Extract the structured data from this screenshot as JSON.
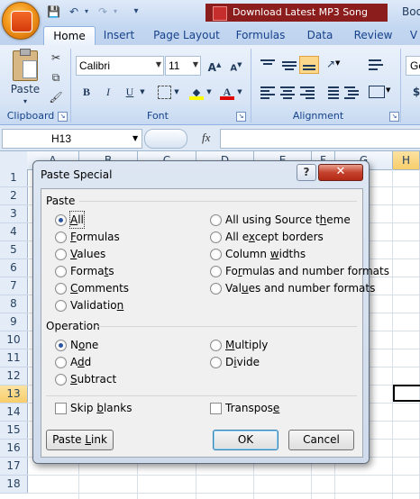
{
  "title_bar": {
    "quick_access": {
      "save": "💾",
      "undo": "↶",
      "undo_dd": "▾",
      "redo": "↷",
      "redo_dd": "▾",
      "customize": "▾"
    },
    "taskbar_app_label": "Download Latest MP3 Song",
    "window_title": "Boo"
  },
  "tabs": [
    "Home",
    "Insert",
    "Page Layout",
    "Formulas",
    "Data",
    "Review",
    "V"
  ],
  "ribbon": {
    "clipboard": {
      "paste_label": "Paste",
      "group_label": "Clipboard"
    },
    "font": {
      "name": "Calibri",
      "size": "11",
      "group_label": "Font",
      "bold": "B",
      "italic": "I",
      "underline": "U",
      "color_glyph": "A",
      "grow": "A",
      "shrink": "A"
    },
    "alignment": {
      "group_label": "Alignment"
    },
    "number": {
      "format_value": "Ge",
      "currency": "$"
    }
  },
  "formula_bar": {
    "name_box": "H13",
    "fx": "fx",
    "formula": ""
  },
  "grid": {
    "columns": [
      "A",
      "B",
      "C",
      "D",
      "E",
      "F",
      "G",
      "H"
    ],
    "rows": [
      "1",
      "2",
      "3",
      "4",
      "5",
      "6",
      "7",
      "8",
      "9",
      "10",
      "11",
      "12",
      "13",
      "14",
      "15",
      "16",
      "17",
      "18"
    ],
    "selected_row": "13",
    "selected_col": "H"
  },
  "dialog": {
    "title": "Paste Special",
    "help": "?",
    "close": "✕",
    "paste_section": "Paste",
    "paste_options_left": [
      {
        "pre": "",
        "key": "A",
        "post": "ll",
        "selected": true
      },
      {
        "pre": "",
        "key": "F",
        "post": "ormulas",
        "selected": false
      },
      {
        "pre": "",
        "key": "V",
        "post": "alues",
        "selected": false
      },
      {
        "pre": "Forma",
        "key": "t",
        "post": "s",
        "selected": false
      },
      {
        "pre": "",
        "key": "C",
        "post": "omments",
        "selected": false
      },
      {
        "pre": "Validatio",
        "key": "n",
        "post": "",
        "selected": false
      }
    ],
    "paste_options_right": [
      {
        "pre": "All using Source t",
        "key": "h",
        "post": "eme",
        "selected": false
      },
      {
        "pre": "All e",
        "key": "x",
        "post": "cept borders",
        "selected": false
      },
      {
        "pre": "Column ",
        "key": "w",
        "post": "idths",
        "selected": false
      },
      {
        "pre": "Fo",
        "key": "r",
        "post": "mulas and number formats",
        "selected": false
      },
      {
        "pre": "Val",
        "key": "u",
        "post": "es and number formats",
        "selected": false
      }
    ],
    "operation_section": "Operation",
    "operation_left": [
      {
        "pre": "N",
        "key": "o",
        "post": "ne",
        "selected": true
      },
      {
        "pre": "A",
        "key": "d",
        "post": "d",
        "selected": false
      },
      {
        "pre": "",
        "key": "S",
        "post": "ubtract",
        "selected": false
      }
    ],
    "operation_right": [
      {
        "pre": "",
        "key": "M",
        "post": "ultiply",
        "selected": false
      },
      {
        "pre": "D",
        "key": "i",
        "post": "vide",
        "selected": false
      }
    ],
    "skip_blanks": {
      "pre": "Skip ",
      "key": "b",
      "post": "lanks",
      "checked": false
    },
    "transpose": {
      "pre": "Transpos",
      "key": "e",
      "post": "",
      "checked": false
    },
    "paste_link": {
      "pre": "Paste ",
      "key": "L",
      "post": "ink"
    },
    "ok": "OK",
    "cancel": "Cancel"
  }
}
